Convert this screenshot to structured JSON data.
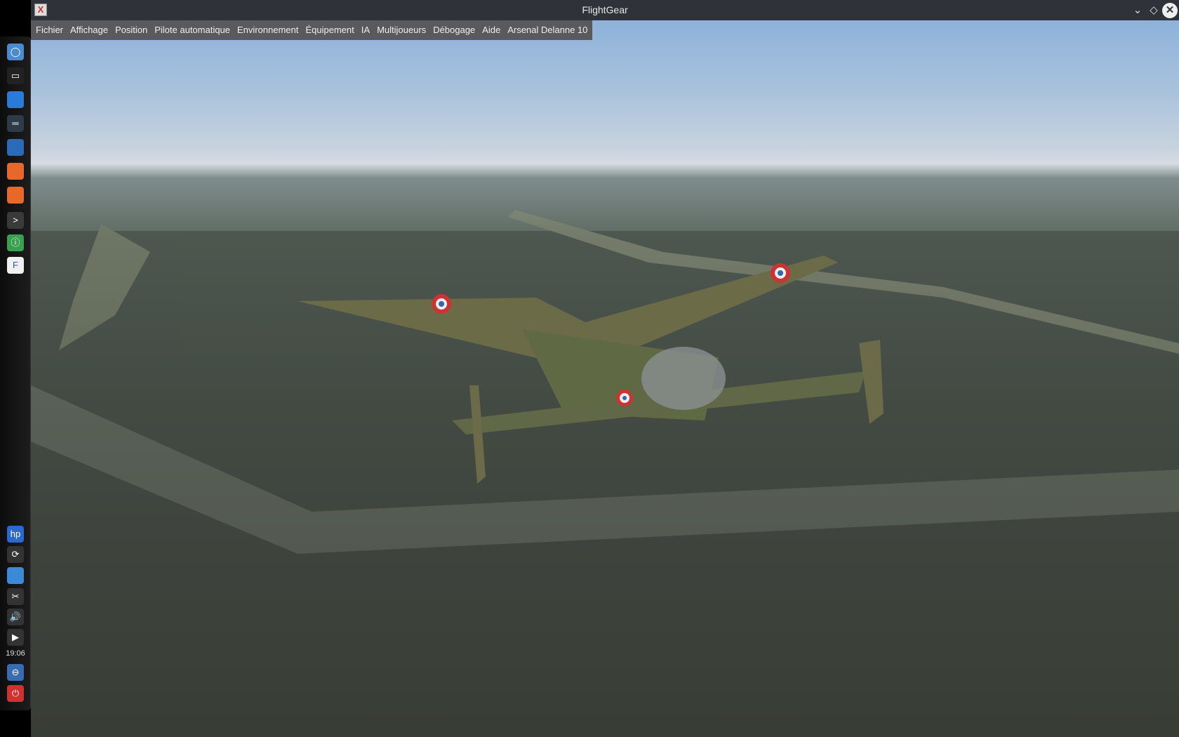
{
  "window": {
    "title": "FlightGear",
    "controls": [
      "minimize",
      "maximize",
      "close"
    ]
  },
  "menu": {
    "items": [
      "Fichier",
      "Affichage",
      "Position",
      "Pilote automatique",
      "Environnement",
      "Équipement",
      "IA",
      "Multijoueurs",
      "Débogage",
      "Aide",
      "Arsenal Delanne 10"
    ]
  },
  "taskbar": {
    "launchers": [
      {
        "name": "menu-icon",
        "color": "#4a8ad0"
      },
      {
        "name": "desktop-icon",
        "color": "#222"
      },
      {
        "name": "file-manager-icon",
        "color": "#2a7ad8"
      },
      {
        "name": "settings-icon",
        "color": "#2d3a48"
      },
      {
        "name": "system-settings-icon",
        "color": "#2a6ab8"
      },
      {
        "name": "firefox-icon",
        "color": "#e8682a"
      },
      {
        "name": "firefox-icon",
        "color": "#e8682a"
      },
      {
        "name": "terminal-icon",
        "color": "#3a3a3a"
      },
      {
        "name": "info-center-icon",
        "color": "#3aa050"
      },
      {
        "name": "flightgear-icon",
        "color": "#f0f0f0"
      }
    ],
    "tray": [
      {
        "name": "hp-icon",
        "color": "#2a6ad0"
      },
      {
        "name": "update-icon",
        "color": "#333"
      },
      {
        "name": "network-icon",
        "color": "#3a8ad8"
      },
      {
        "name": "scissors-icon",
        "color": "#333"
      },
      {
        "name": "volume-icon",
        "color": "#333"
      },
      {
        "name": "expand-arrow-icon",
        "color": "#333"
      }
    ],
    "clock": "19:06",
    "bottom": [
      {
        "name": "lock-icon",
        "color": "#3a6ab0"
      },
      {
        "name": "power-icon",
        "color": "#d03030"
      }
    ]
  }
}
